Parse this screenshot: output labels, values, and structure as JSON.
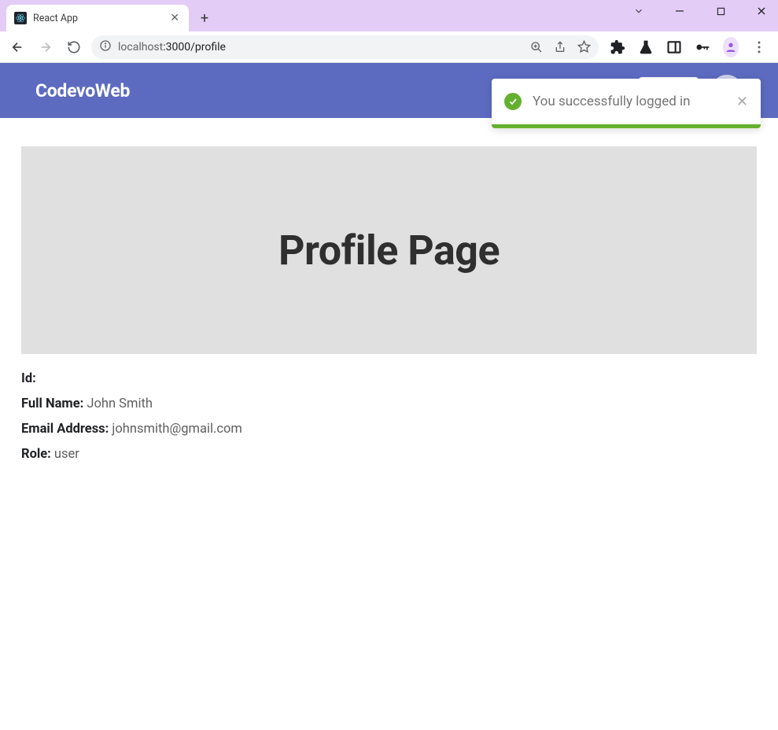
{
  "browser": {
    "tab_title": "React App",
    "url_host": "localhost",
    "url_port_path": ":3000/profile"
  },
  "header": {
    "brand": "CodevoWeb"
  },
  "toast": {
    "message": "You successfully logged in"
  },
  "page": {
    "title": "Profile Page",
    "fields": {
      "id_label": "Id:",
      "id_value": "",
      "name_label": "Full Name:",
      "name_value": "John Smith",
      "email_label": "Email Address:",
      "email_value": "johnsmith@gmail.com",
      "role_label": "Role:",
      "role_value": "user"
    }
  }
}
